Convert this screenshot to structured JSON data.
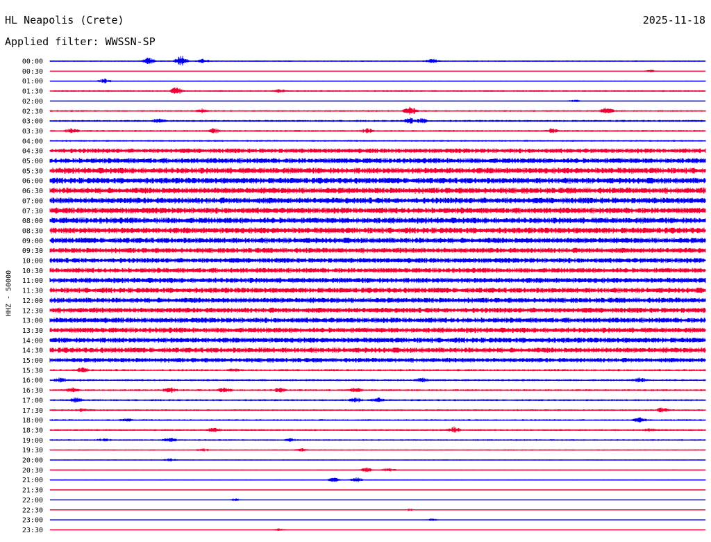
{
  "header": {
    "station": "HL Neapolis (Crete)",
    "date": "2025-11-18",
    "filter": "Applied filter: WWSSN-SP"
  },
  "side_label": "HHZ - 50000",
  "colors": {
    "trace_even": "#0000ee",
    "trace_odd": "#ee0033",
    "background": "#ffffff"
  },
  "chart_data": {
    "type": "line",
    "title": "HL Neapolis (Crete)",
    "subtitle": "Applied filter: WWSSN-SP",
    "ylabel": "HHZ - 50000",
    "xlabel": "",
    "x_unit": "minutes within 30-minute row",
    "x_range": [
      0,
      30
    ],
    "categories": [
      "00:00",
      "00:30",
      "01:00",
      "01:30",
      "02:00",
      "02:30",
      "03:00",
      "03:30",
      "04:00",
      "04:30",
      "05:00",
      "05:30",
      "06:00",
      "06:30",
      "07:00",
      "07:30",
      "08:00",
      "08:30",
      "09:00",
      "09:30",
      "10:00",
      "10:30",
      "11:00",
      "11:30",
      "12:00",
      "12:30",
      "13:00",
      "13:30",
      "14:00",
      "14:30",
      "15:00",
      "15:30",
      "16:00",
      "16:30",
      "17:00",
      "17:30",
      "18:00",
      "18:30",
      "19:00",
      "19:30",
      "20:00",
      "20:30",
      "21:00",
      "21:30",
      "22:00",
      "22:30",
      "23:00",
      "23:30"
    ],
    "row_amplitude": [
      1,
      0.4,
      0.8,
      1.2,
      0.5,
      1.3,
      1.5,
      1.4,
      1.3,
      3.5,
      4,
      4.5,
      4.5,
      4.5,
      4.5,
      4.5,
      4.5,
      4.5,
      4.2,
      4,
      3.8,
      3.8,
      4,
      4,
      4,
      4,
      4,
      4,
      4,
      4,
      3.5,
      1.6,
      1.5,
      1.5,
      1.4,
      1.3,
      1.3,
      1.3,
      1.2,
      1,
      0.8,
      0.8,
      0.8,
      0.5,
      0.4,
      0.3,
      0.3,
      0.3
    ],
    "events": [
      {
        "row": 0,
        "minute": 4.5,
        "amplitude": 5.5
      },
      {
        "row": 0,
        "minute": 6.0,
        "amplitude": 9
      },
      {
        "row": 0,
        "minute": 7.0,
        "amplitude": 2.5
      },
      {
        "row": 0,
        "minute": 17.5,
        "amplitude": 3
      },
      {
        "row": 1,
        "minute": 27.5,
        "amplitude": 2
      },
      {
        "row": 2,
        "minute": 2.5,
        "amplitude": 3
      },
      {
        "row": 3,
        "minute": 5.8,
        "amplitude": 5
      },
      {
        "row": 3,
        "minute": 10.5,
        "amplitude": 2
      },
      {
        "row": 4,
        "minute": 24.0,
        "amplitude": 2
      },
      {
        "row": 5,
        "minute": 7.0,
        "amplitude": 3
      },
      {
        "row": 5,
        "minute": 16.5,
        "amplitude": 6
      },
      {
        "row": 5,
        "minute": 25.5,
        "amplitude": 5
      },
      {
        "row": 6,
        "minute": 5.0,
        "amplitude": 3
      },
      {
        "row": 6,
        "minute": 16.5,
        "amplitude": 4
      },
      {
        "row": 6,
        "minute": 17.0,
        "amplitude": 3
      },
      {
        "row": 7,
        "minute": 1.0,
        "amplitude": 3
      },
      {
        "row": 7,
        "minute": 7.5,
        "amplitude": 3
      },
      {
        "row": 7,
        "minute": 14.5,
        "amplitude": 3
      },
      {
        "row": 7,
        "minute": 23.0,
        "amplitude": 3
      },
      {
        "row": 31,
        "minute": 1.5,
        "amplitude": 3
      },
      {
        "row": 31,
        "minute": 8.5,
        "amplitude": 2
      },
      {
        "row": 32,
        "minute": 0.5,
        "amplitude": 3
      },
      {
        "row": 32,
        "minute": 17.0,
        "amplitude": 3
      },
      {
        "row": 32,
        "minute": 27.0,
        "amplitude": 3
      },
      {
        "row": 33,
        "minute": 1.0,
        "amplitude": 3
      },
      {
        "row": 33,
        "minute": 5.5,
        "amplitude": 3
      },
      {
        "row": 33,
        "minute": 8.0,
        "amplitude": 3
      },
      {
        "row": 33,
        "minute": 10.5,
        "amplitude": 3
      },
      {
        "row": 33,
        "minute": 14.0,
        "amplitude": 3
      },
      {
        "row": 34,
        "minute": 1.2,
        "amplitude": 3
      },
      {
        "row": 34,
        "minute": 14.0,
        "amplitude": 3
      },
      {
        "row": 34,
        "minute": 15.0,
        "amplitude": 3
      },
      {
        "row": 35,
        "minute": 1.5,
        "amplitude": 2
      },
      {
        "row": 35,
        "minute": 28.0,
        "amplitude": 3
      },
      {
        "row": 36,
        "minute": 3.5,
        "amplitude": 2
      },
      {
        "row": 36,
        "minute": 27.0,
        "amplitude": 3
      },
      {
        "row": 37,
        "minute": 7.5,
        "amplitude": 3
      },
      {
        "row": 37,
        "minute": 18.5,
        "amplitude": 4
      },
      {
        "row": 37,
        "minute": 27.5,
        "amplitude": 2
      },
      {
        "row": 38,
        "minute": 2.5,
        "amplitude": 2
      },
      {
        "row": 38,
        "minute": 5.5,
        "amplitude": 3
      },
      {
        "row": 38,
        "minute": 11.0,
        "amplitude": 2
      },
      {
        "row": 39,
        "minute": 7.0,
        "amplitude": 2
      },
      {
        "row": 39,
        "minute": 11.5,
        "amplitude": 2
      },
      {
        "row": 40,
        "minute": 5.5,
        "amplitude": 2
      },
      {
        "row": 41,
        "minute": 14.5,
        "amplitude": 3
      },
      {
        "row": 41,
        "minute": 15.5,
        "amplitude": 3
      },
      {
        "row": 42,
        "minute": 13.0,
        "amplitude": 3
      },
      {
        "row": 42,
        "minute": 14.0,
        "amplitude": 4
      },
      {
        "row": 44,
        "minute": 8.5,
        "amplitude": 2
      },
      {
        "row": 45,
        "minute": 16.5,
        "amplitude": 2
      },
      {
        "row": 46,
        "minute": 17.5,
        "amplitude": 2
      },
      {
        "row": 47,
        "minute": 10.5,
        "amplitude": 2
      }
    ]
  }
}
